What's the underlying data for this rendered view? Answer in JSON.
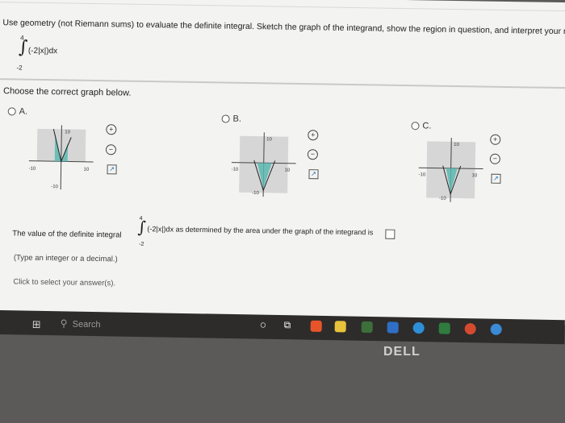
{
  "question": "Use geometry (not Riemann sums) to evaluate the definite integral. Sketch the graph of the integrand, show the region in question, and interpret your result.",
  "integral": {
    "upper": "4",
    "lower": "-2",
    "expression": "(-2|x|)dx"
  },
  "choose_label": "Choose the correct graph below.",
  "options": [
    {
      "label": "A.",
      "axis_label_top": "10",
      "axis_label_bottom": "-10",
      "axis_left": "-10",
      "axis_right": "10"
    },
    {
      "label": "B.",
      "axis_label_top": "10",
      "axis_label_bottom": "-10",
      "axis_left": "-10",
      "axis_right": "10"
    },
    {
      "label": "C.",
      "axis_label_top": "10",
      "axis_label_bottom": "-10",
      "axis_left": "-10",
      "axis_right": "10"
    }
  ],
  "value_text_before": "The value of the definite integral",
  "value_text_after": "as determined by the area under the graph of the integrand is",
  "hint": "(Type an integer or a decimal.)",
  "select_note": "Click to select your answer(s).",
  "taskbar": {
    "search_placeholder": "Search"
  },
  "brand": "DELL"
}
